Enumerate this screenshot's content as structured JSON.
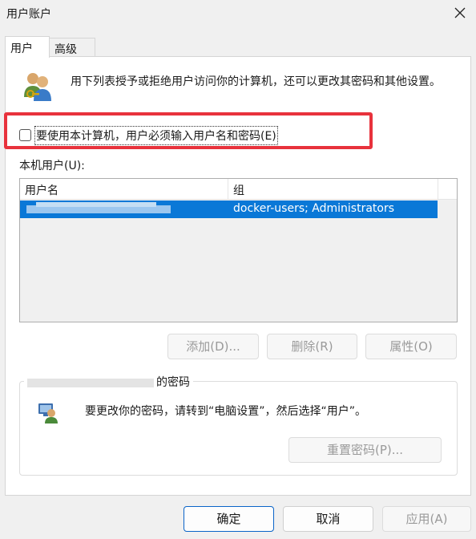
{
  "window": {
    "title": "用户账户"
  },
  "tabs": [
    {
      "label": "用户",
      "active": true
    },
    {
      "label": "高级",
      "active": false
    }
  ],
  "intro": {
    "text": "用下列表授予或拒绝用户访问你的计算机，还可以更改其密码和其他设置。"
  },
  "require_password": {
    "label": "要使用本计算机，用户必须输入用户名和密码(E)",
    "checked": false
  },
  "local_users": {
    "label": "本机用户(U):",
    "columns": [
      "用户名",
      "组"
    ],
    "rows": [
      {
        "username": "",
        "group": "docker-users; Administrators",
        "selected": true
      }
    ]
  },
  "user_buttons": {
    "add": "添加(D)...",
    "remove": "删除(R)",
    "properties": "属性(O)"
  },
  "password_group": {
    "title_suffix": "的密码",
    "text": "要更改你的密码，请转到“电脑设置”，然后选择“用户”。",
    "reset_button": "重置密码(P)..."
  },
  "footer": {
    "ok": "确定",
    "cancel": "取消",
    "apply": "应用(A)"
  },
  "colors": {
    "selection": "#0a78d7",
    "highlight_frame": "#e8323c"
  }
}
